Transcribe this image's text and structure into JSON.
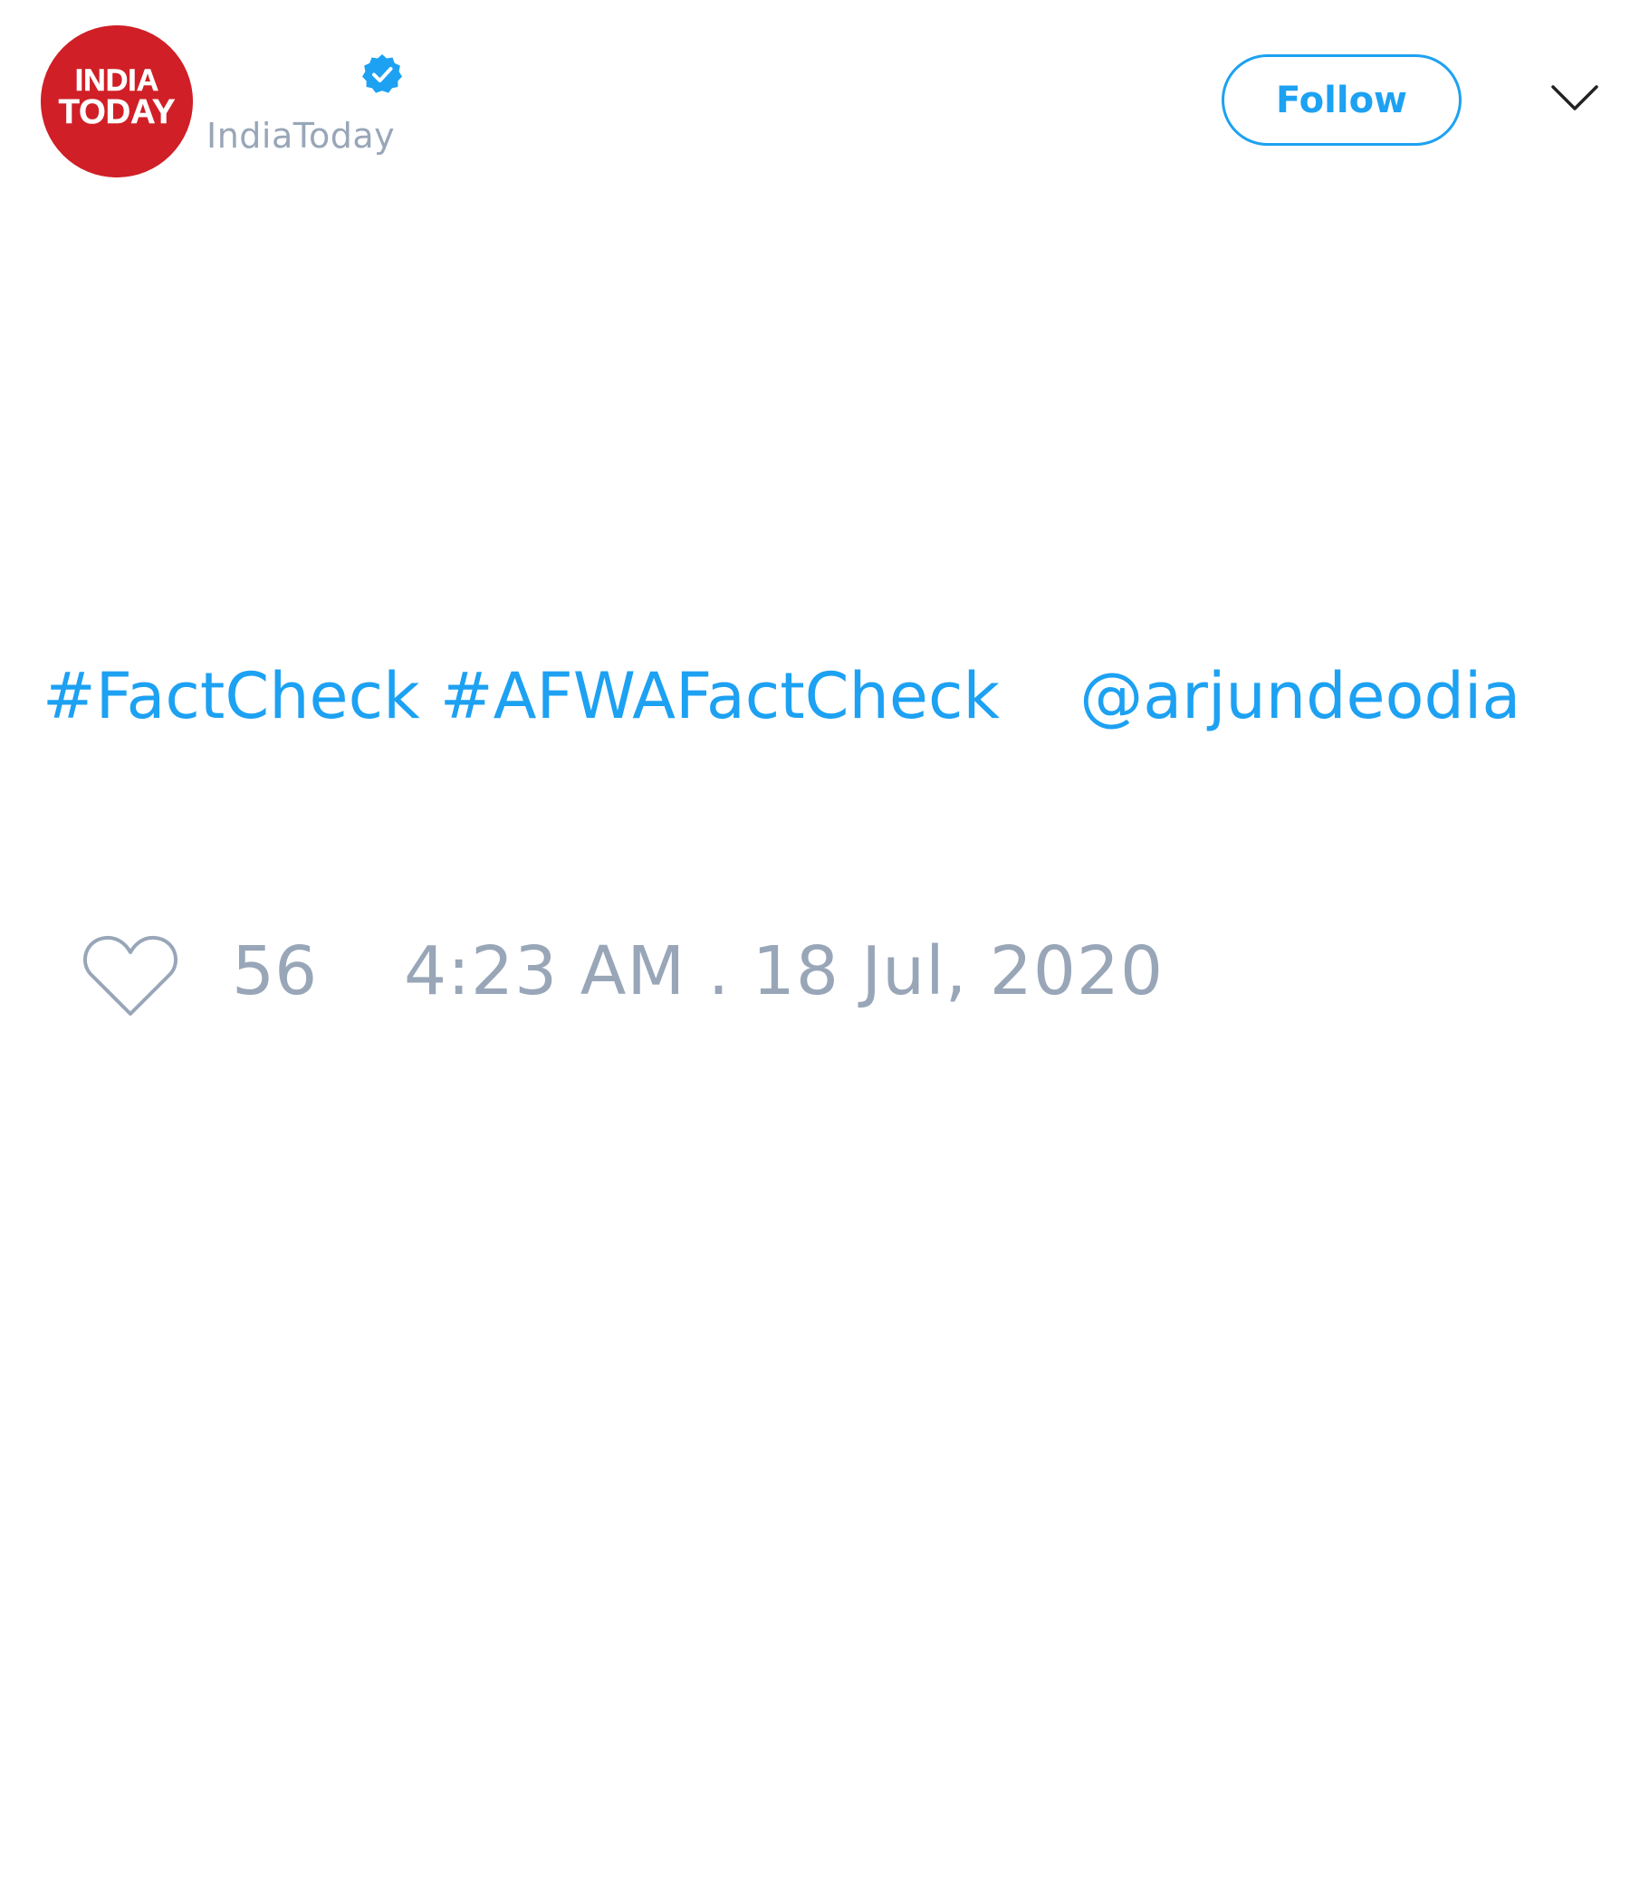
{
  "author": {
    "logo_text_line1": "INDIA",
    "logo_text_line2": "TODAY",
    "handle": "IndiaToday",
    "verified": true,
    "brand_color": "#d01f26"
  },
  "header": {
    "follow_label": "Follow",
    "menu_icon": "chevron-down-icon"
  },
  "tweet": {
    "hashtag1": "#FactCheck",
    "hashtag2": "#AFWAFactCheck",
    "mention": "@arjundeodia"
  },
  "footer": {
    "like_icon": "heart-icon",
    "like_count": "56",
    "timestamp": "4:23 AM . 18 Jul, 2020"
  },
  "colors": {
    "accent": "#1da1f2",
    "muted": "#98a6b8"
  }
}
